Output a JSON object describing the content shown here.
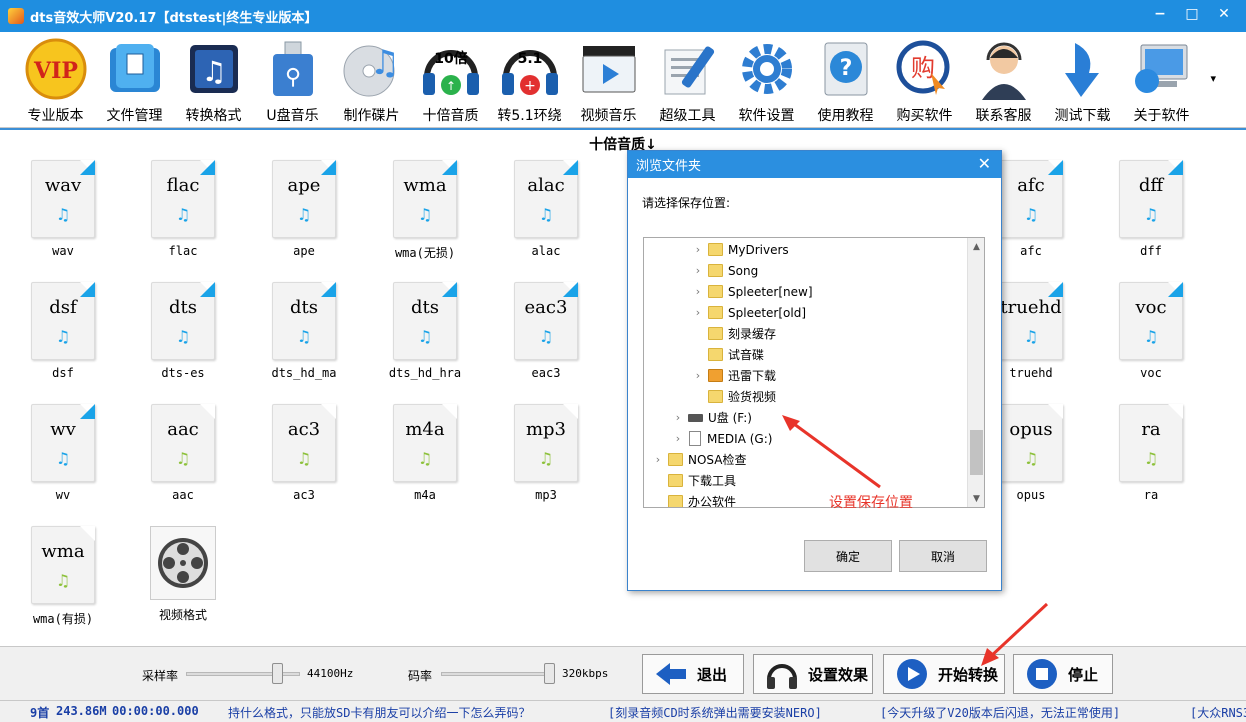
{
  "window": {
    "title": "dts音效大师V20.17【dtstest|终生专业版本】",
    "minimize": "−",
    "maximize": "□",
    "close": "✕"
  },
  "toolbar": [
    {
      "label": "专业版本",
      "icon": "vip-icon"
    },
    {
      "label": "文件管理",
      "icon": "file-manager-icon"
    },
    {
      "label": "转换格式",
      "icon": "music-convert-icon"
    },
    {
      "label": "U盘音乐",
      "icon": "usb-music-icon"
    },
    {
      "label": "制作碟片",
      "icon": "disc-music-icon"
    },
    {
      "label": "十倍音质",
      "icon": "ten-times-quality-icon",
      "badge": "10倍"
    },
    {
      "label": "转5.1环绕",
      "icon": "surround-51-icon",
      "badge": "5.1"
    },
    {
      "label": "视频音乐",
      "icon": "video-music-icon"
    },
    {
      "label": "超级工具",
      "icon": "super-tools-icon"
    },
    {
      "label": "软件设置",
      "icon": "gear-icon"
    },
    {
      "label": "使用教程",
      "icon": "help-icon"
    },
    {
      "label": "购买软件",
      "icon": "buy-icon",
      "badge": "购"
    },
    {
      "label": "联系客服",
      "icon": "customer-service-icon"
    },
    {
      "label": "测试下载",
      "icon": "download-icon"
    },
    {
      "label": "关于软件",
      "icon": "about-computer-icon"
    }
  ],
  "toolbar_more": "▾",
  "workspace": {
    "title": "十倍音质↓",
    "files": [
      {
        "ext": "wav",
        "label": "wav",
        "color": "blue"
      },
      {
        "ext": "flac",
        "label": "flac",
        "color": "blue"
      },
      {
        "ext": "ape",
        "label": "ape",
        "color": "blue"
      },
      {
        "ext": "wma",
        "label": "wma(无损)",
        "color": "blue"
      },
      {
        "ext": "alac",
        "label": "alac",
        "color": "blue"
      },
      {
        "ext": "afc",
        "label": "afc",
        "color": "blue"
      },
      {
        "ext": "dff",
        "label": "dff",
        "color": "blue"
      },
      {
        "ext": "dsf",
        "label": "dsf",
        "color": "blue"
      },
      {
        "ext": "dts",
        "label": "dts-es",
        "color": "blue"
      },
      {
        "ext": "dts",
        "label": "dts_hd_ma",
        "color": "blue"
      },
      {
        "ext": "dts",
        "label": "dts_hd_hra",
        "color": "blue"
      },
      {
        "ext": "eac3",
        "label": "eac3",
        "color": "blue"
      },
      {
        "ext": "truehd",
        "label": "truehd",
        "color": "blue"
      },
      {
        "ext": "voc",
        "label": "voc",
        "color": "blue"
      },
      {
        "ext": "wv",
        "label": "wv",
        "color": "blue"
      },
      {
        "ext": "aac",
        "label": "aac",
        "color": "green"
      },
      {
        "ext": "ac3",
        "label": "ac3",
        "color": "green"
      },
      {
        "ext": "m4a",
        "label": "m4a",
        "color": "green"
      },
      {
        "ext": "mp3",
        "label": "mp3",
        "color": "green"
      },
      {
        "ext": "opus",
        "label": "opus",
        "color": "green"
      },
      {
        "ext": "ra",
        "label": "ra",
        "color": "green"
      },
      {
        "ext": "wma",
        "label": "wma(有损)",
        "color": "green"
      }
    ],
    "video_format_label": "视频格式"
  },
  "dialog": {
    "title": "浏览文件夹",
    "close": "✕",
    "prompt": "请选择保存位置:",
    "tree": [
      {
        "name": "MyDrivers",
        "type": "folder",
        "expandable": true
      },
      {
        "name": "Song",
        "type": "folder",
        "expandable": true
      },
      {
        "name": "Spleeter[new]",
        "type": "folder",
        "expandable": true
      },
      {
        "name": "Spleeter[old]",
        "type": "folder",
        "expandable": true
      },
      {
        "name": "刻录缓存",
        "type": "folder",
        "expandable": false
      },
      {
        "name": "试音碟",
        "type": "folder",
        "expandable": false
      },
      {
        "name": "迅雷下载",
        "type": "folder-special",
        "expandable": true
      },
      {
        "name": "验货视频",
        "type": "folder",
        "expandable": false
      },
      {
        "name": "U盘 (F:)",
        "type": "drive",
        "expandable": true
      },
      {
        "name": "MEDIA (G:)",
        "type": "media",
        "expandable": true
      },
      {
        "name": "NOSA检查",
        "type": "folder",
        "expandable": true
      },
      {
        "name": "下载工具",
        "type": "folder",
        "expandable": false
      },
      {
        "name": "办公软件",
        "type": "folder",
        "expandable": false
      }
    ],
    "annotation": "设置保存位置",
    "ok_label": "确定",
    "cancel_label": "取消"
  },
  "controls": {
    "sample_rate_label": "采样率",
    "sample_rate_value": "44100Hz",
    "sample_rate_level": 0.8,
    "bitrate_label": "码率",
    "bitrate_value": "320kbps",
    "bitrate_level": 1.0,
    "exit_label": "退出",
    "effects_label": "设置效果",
    "start_label": "开始转换",
    "stop_label": "停止"
  },
  "status": {
    "count": "9首",
    "size": "243.86M",
    "time": "00:00:00.000",
    "msg1": "持什么格式，只能放SD卡有朋友可以介绍一下怎么弄码？",
    "msg2": "[刻录音频CD时系统弹出需要安装NERO]",
    "msg3": "[今天升级了V20版本后闪退，无法正常使用]",
    "msg4": "[大众RNS3"
  },
  "colors": {
    "accent": "#1f8ee0",
    "annotation_red": "#e8342a",
    "lossless_blue": "#1aa3e8",
    "lossy_green": "#8dc13b",
    "status_text": "#1a3fa6"
  }
}
